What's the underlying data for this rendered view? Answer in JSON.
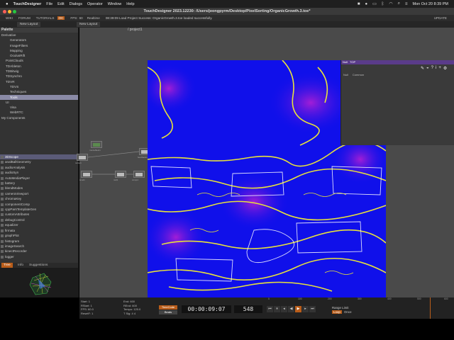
{
  "menubar": {
    "app": "TouchDesigner",
    "items": [
      "File",
      "Edit",
      "Dialogs",
      "Operator",
      "Window",
      "Help"
    ],
    "clock": "Mon Oct 20  8:39 PM"
  },
  "window": {
    "title": "TouchDesigner 2023.12230: /Users/jeongpyrm/Desktop/PixelSorting/OrganicGrowth.3.toe*"
  },
  "toolbar": {
    "user": "WIKI",
    "forum": "FORUM",
    "tutorials": "TUTORIALS",
    "perf": "OC",
    "fps_label": "FPS:",
    "fps_value": "60",
    "realtime": "Realtime",
    "status": "08:39:09 Load Project Success: OrganicGrowth.3.toe loaded successfully.",
    "update": "UPDATE"
  },
  "panes": {
    "left_tab": "New Layout",
    "right_tab": "New Layout"
  },
  "palette": {
    "header": "Palette",
    "tree": [
      {
        "label": "Derivative",
        "indent": 0,
        "sel": false
      },
      {
        "label": "Generators",
        "indent": 2,
        "sel": false
      },
      {
        "label": "ImageFilters",
        "indent": 2,
        "sel": false
      },
      {
        "label": "Mapping",
        "indent": 2,
        "sel": false
      },
      {
        "label": "OculusRift",
        "indent": 2,
        "sel": false
      },
      {
        "label": "PointClouds",
        "indent": 1,
        "sel": false
      },
      {
        "label": "TDAbleton",
        "indent": 1,
        "sel": false
      },
      {
        "label": "TDBitwig",
        "indent": 1,
        "sel": false
      },
      {
        "label": "TDSynchro",
        "indent": 1,
        "sel": false
      },
      {
        "label": "TDVR",
        "indent": 1,
        "sel": false
      },
      {
        "label": "TDVS",
        "indent": 2,
        "sel": false
      },
      {
        "label": "Techniques",
        "indent": 2,
        "sel": false
      },
      {
        "label": "Tools",
        "indent": 2,
        "sel": true
      },
      {
        "label": "UI",
        "indent": 1,
        "sel": false
      },
      {
        "label": "Visa",
        "indent": 2,
        "sel": false
      },
      {
        "label": "WebRTC",
        "indent": 2,
        "sel": false
      },
      {
        "label": "My Components",
        "indent": 0,
        "sel": false
      }
    ],
    "list": [
      {
        "label": "3DScope",
        "sel": true
      },
      {
        "label": "analBallGeometry",
        "sel": false
      },
      {
        "label": "audioAnalysis",
        "sel": false
      },
      {
        "label": "audioSyn",
        "sel": false
      },
      {
        "label": "AutoMediaPlayer",
        "sel": false
      },
      {
        "label": "battery",
        "sel": false
      },
      {
        "label": "blendModes",
        "sel": false
      },
      {
        "label": "cameraViewport",
        "sel": false
      },
      {
        "label": "chromaKey",
        "sel": false
      },
      {
        "label": "componentComp",
        "sel": false
      },
      {
        "label": "cppParsTemplateGen",
        "sel": false
      },
      {
        "label": "customAttributes",
        "sel": false
      },
      {
        "label": "debugControl",
        "sel": false
      },
      {
        "label": "equalizer",
        "sel": false
      },
      {
        "label": "firmata",
        "sel": false
      },
      {
        "label": "graphPlot",
        "sel": false
      },
      {
        "label": "histogram",
        "sel": false
      },
      {
        "label": "imageSearch",
        "sel": false
      },
      {
        "label": "kinectRecorder",
        "sel": false
      },
      {
        "label": "logger",
        "sel": false
      }
    ],
    "tabs": [
      "Tree",
      "Info",
      "Suggestions"
    ]
  },
  "network": {
    "path": "/ project1",
    "nodes": [
      {
        "label": "moviefilein1"
      },
      {
        "label": "noise1"
      },
      {
        "label": "level1"
      },
      {
        "label": "null1"
      },
      {
        "label": "feedback1"
      },
      {
        "label": "comp1"
      },
      {
        "label": "blur1"
      },
      {
        "label": "edge1"
      },
      {
        "label": "out1"
      }
    ]
  },
  "params": {
    "name": "Null",
    "op": "TOP",
    "tabs": [
      "Null",
      "Common"
    ]
  },
  "timeline": {
    "start_label": "Start:",
    "start_value": "1",
    "rstart_label": "RStart:",
    "rstart_value": "1",
    "fps_label": "FPS:",
    "fps_value": "60.0",
    "resetf_label": "ResetF:",
    "resetf_value": "1",
    "end_label": "End:",
    "end_value": "600",
    "rend_label": "REnd:",
    "rend_value": "600",
    "tempo_label": "Tempo:",
    "tempo_value": "120.0",
    "tsig_label": "T Sig:",
    "tsig_value": "4  4",
    "timecode_btn": "TimeCode",
    "beats_btn": "Beats",
    "timecode": "00:00:09:07",
    "frame": "548",
    "range_limit": "Range Limit",
    "loop": "Loop",
    "once": "Once",
    "ruler": [
      "0",
      "100",
      "200",
      "300",
      "400",
      "500",
      "600"
    ]
  },
  "colors": {
    "viewer_bg": "#1010ea",
    "accent_orange": "#b95d1a",
    "param_bar": "#5a3b8a"
  }
}
